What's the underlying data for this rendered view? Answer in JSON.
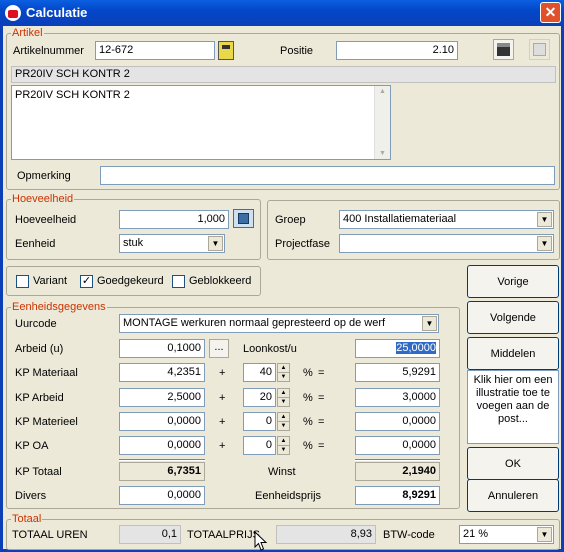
{
  "window": {
    "title": "Calculatie"
  },
  "artikel": {
    "legend": "Artikel",
    "artikelnummer_label": "Artikelnummer",
    "artikelnummer": "12-672",
    "positie_label": "Positie",
    "positie": "2.10",
    "short_desc": "PR20IV SCH KONTR 2",
    "long_desc": "PR20IV SCH KONTR 2",
    "opmerking_label": "Opmerking",
    "opmerking": ""
  },
  "hoeveelheid": {
    "legend": "Hoeveelheid",
    "hoeveelheid_label": "Hoeveelheid",
    "hoeveelheid": "1,000",
    "eenheid_label": "Eenheid",
    "eenheid": "stuk"
  },
  "groep": {
    "groep_label": "Groep",
    "groep": "400  Installatiemateriaal",
    "projectfase_label": "Projectfase",
    "projectfase": ""
  },
  "flags": {
    "variant_label": "Variant",
    "variant_checked": false,
    "goedgekeurd_label": "Goedgekeurd",
    "goedgekeurd_checked": true,
    "geblokkeerd_label": "Geblokkeerd",
    "geblokkeerd_checked": false,
    "check_mark": "✓"
  },
  "eenheidsgegevens": {
    "legend": "Eenheidsgegevens",
    "uurcode_label": "Uurcode",
    "uurcode": "MONTAGE  werkuren normaal gepresteerd op de werf",
    "arbeid_label": "Arbeid (u)",
    "arbeid": "0,1000",
    "ellipsis": "...",
    "loonkost_label": "Loonkost/u",
    "loonkost": "25,0000",
    "rows": [
      {
        "label": "KP Materiaal",
        "value": "4,2351",
        "pct": "40",
        "result": "5,9291"
      },
      {
        "label": "KP Arbeid",
        "value": "2,5000",
        "pct": "20",
        "result": "3,0000"
      },
      {
        "label": "KP Materieel",
        "value": "0,0000",
        "pct": "0",
        "result": "0,0000"
      },
      {
        "label": "KP OA",
        "value": "0,0000",
        "pct": "0",
        "result": "0,0000"
      }
    ],
    "plus": "+",
    "pct_sign": "%",
    "equals": "=",
    "kp_totaal_label": "KP Totaal",
    "kp_totaal": "6,7351",
    "winst_label": "Winst",
    "winst": "2,1940",
    "divers_label": "Divers",
    "divers": "0,0000",
    "eenheidsprijs_label": "Eenheidsprijs",
    "eenheidsprijs": "8,9291"
  },
  "buttons": {
    "vorige": "Vorige",
    "volgende": "Volgende",
    "middelen": "Middelen",
    "ok": "OK",
    "annuleren": "Annuleren"
  },
  "illustratie_hint": "Klik hier om een illustratie toe te voegen aan de post...",
  "totaal": {
    "legend": "Totaal",
    "uren_label": "TOTAAL UREN",
    "uren": "0,1",
    "prijs_label": "TOTAALPRIJS",
    "prijs": "8,93",
    "btw_label": "BTW-code",
    "btw": "21 %"
  }
}
